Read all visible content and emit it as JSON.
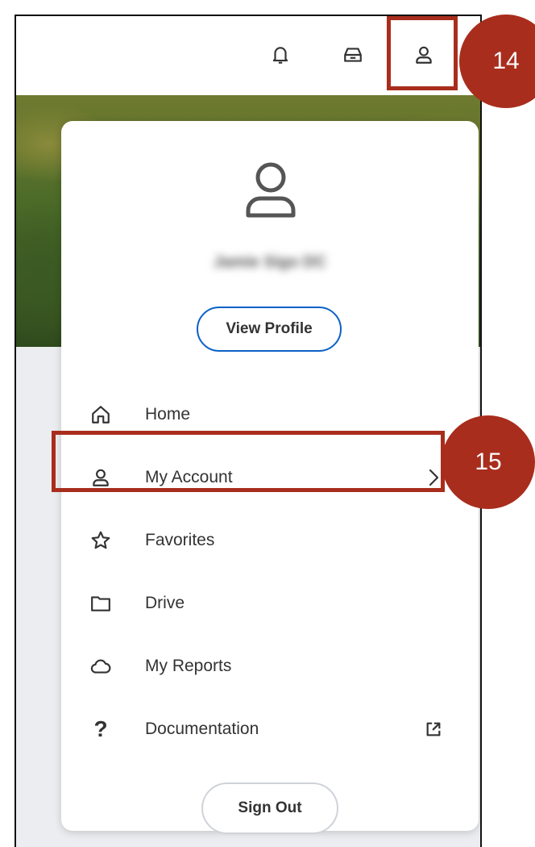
{
  "header": {
    "icons": [
      "bell-icon",
      "inbox-icon",
      "profile-icon"
    ]
  },
  "callouts": {
    "profile_step": "14",
    "account_step": "15"
  },
  "colors": {
    "callout": "#a92d1d",
    "primary_button_border": "#0b61c7"
  },
  "profile_menu": {
    "user_name": "Jamie Sigo DC",
    "view_profile_label": "View Profile",
    "items": [
      {
        "label": "Home",
        "icon": "home-icon"
      },
      {
        "label": "My Account",
        "icon": "user-icon",
        "trailing": "chevron-right-icon"
      },
      {
        "label": "Favorites",
        "icon": "star-icon"
      },
      {
        "label": "Drive",
        "icon": "folder-icon"
      },
      {
        "label": "My Reports",
        "icon": "cloud-icon"
      },
      {
        "label": "Documentation",
        "icon": "question-icon",
        "trailing": "external-link-icon"
      }
    ],
    "sign_out_label": "Sign Out"
  }
}
